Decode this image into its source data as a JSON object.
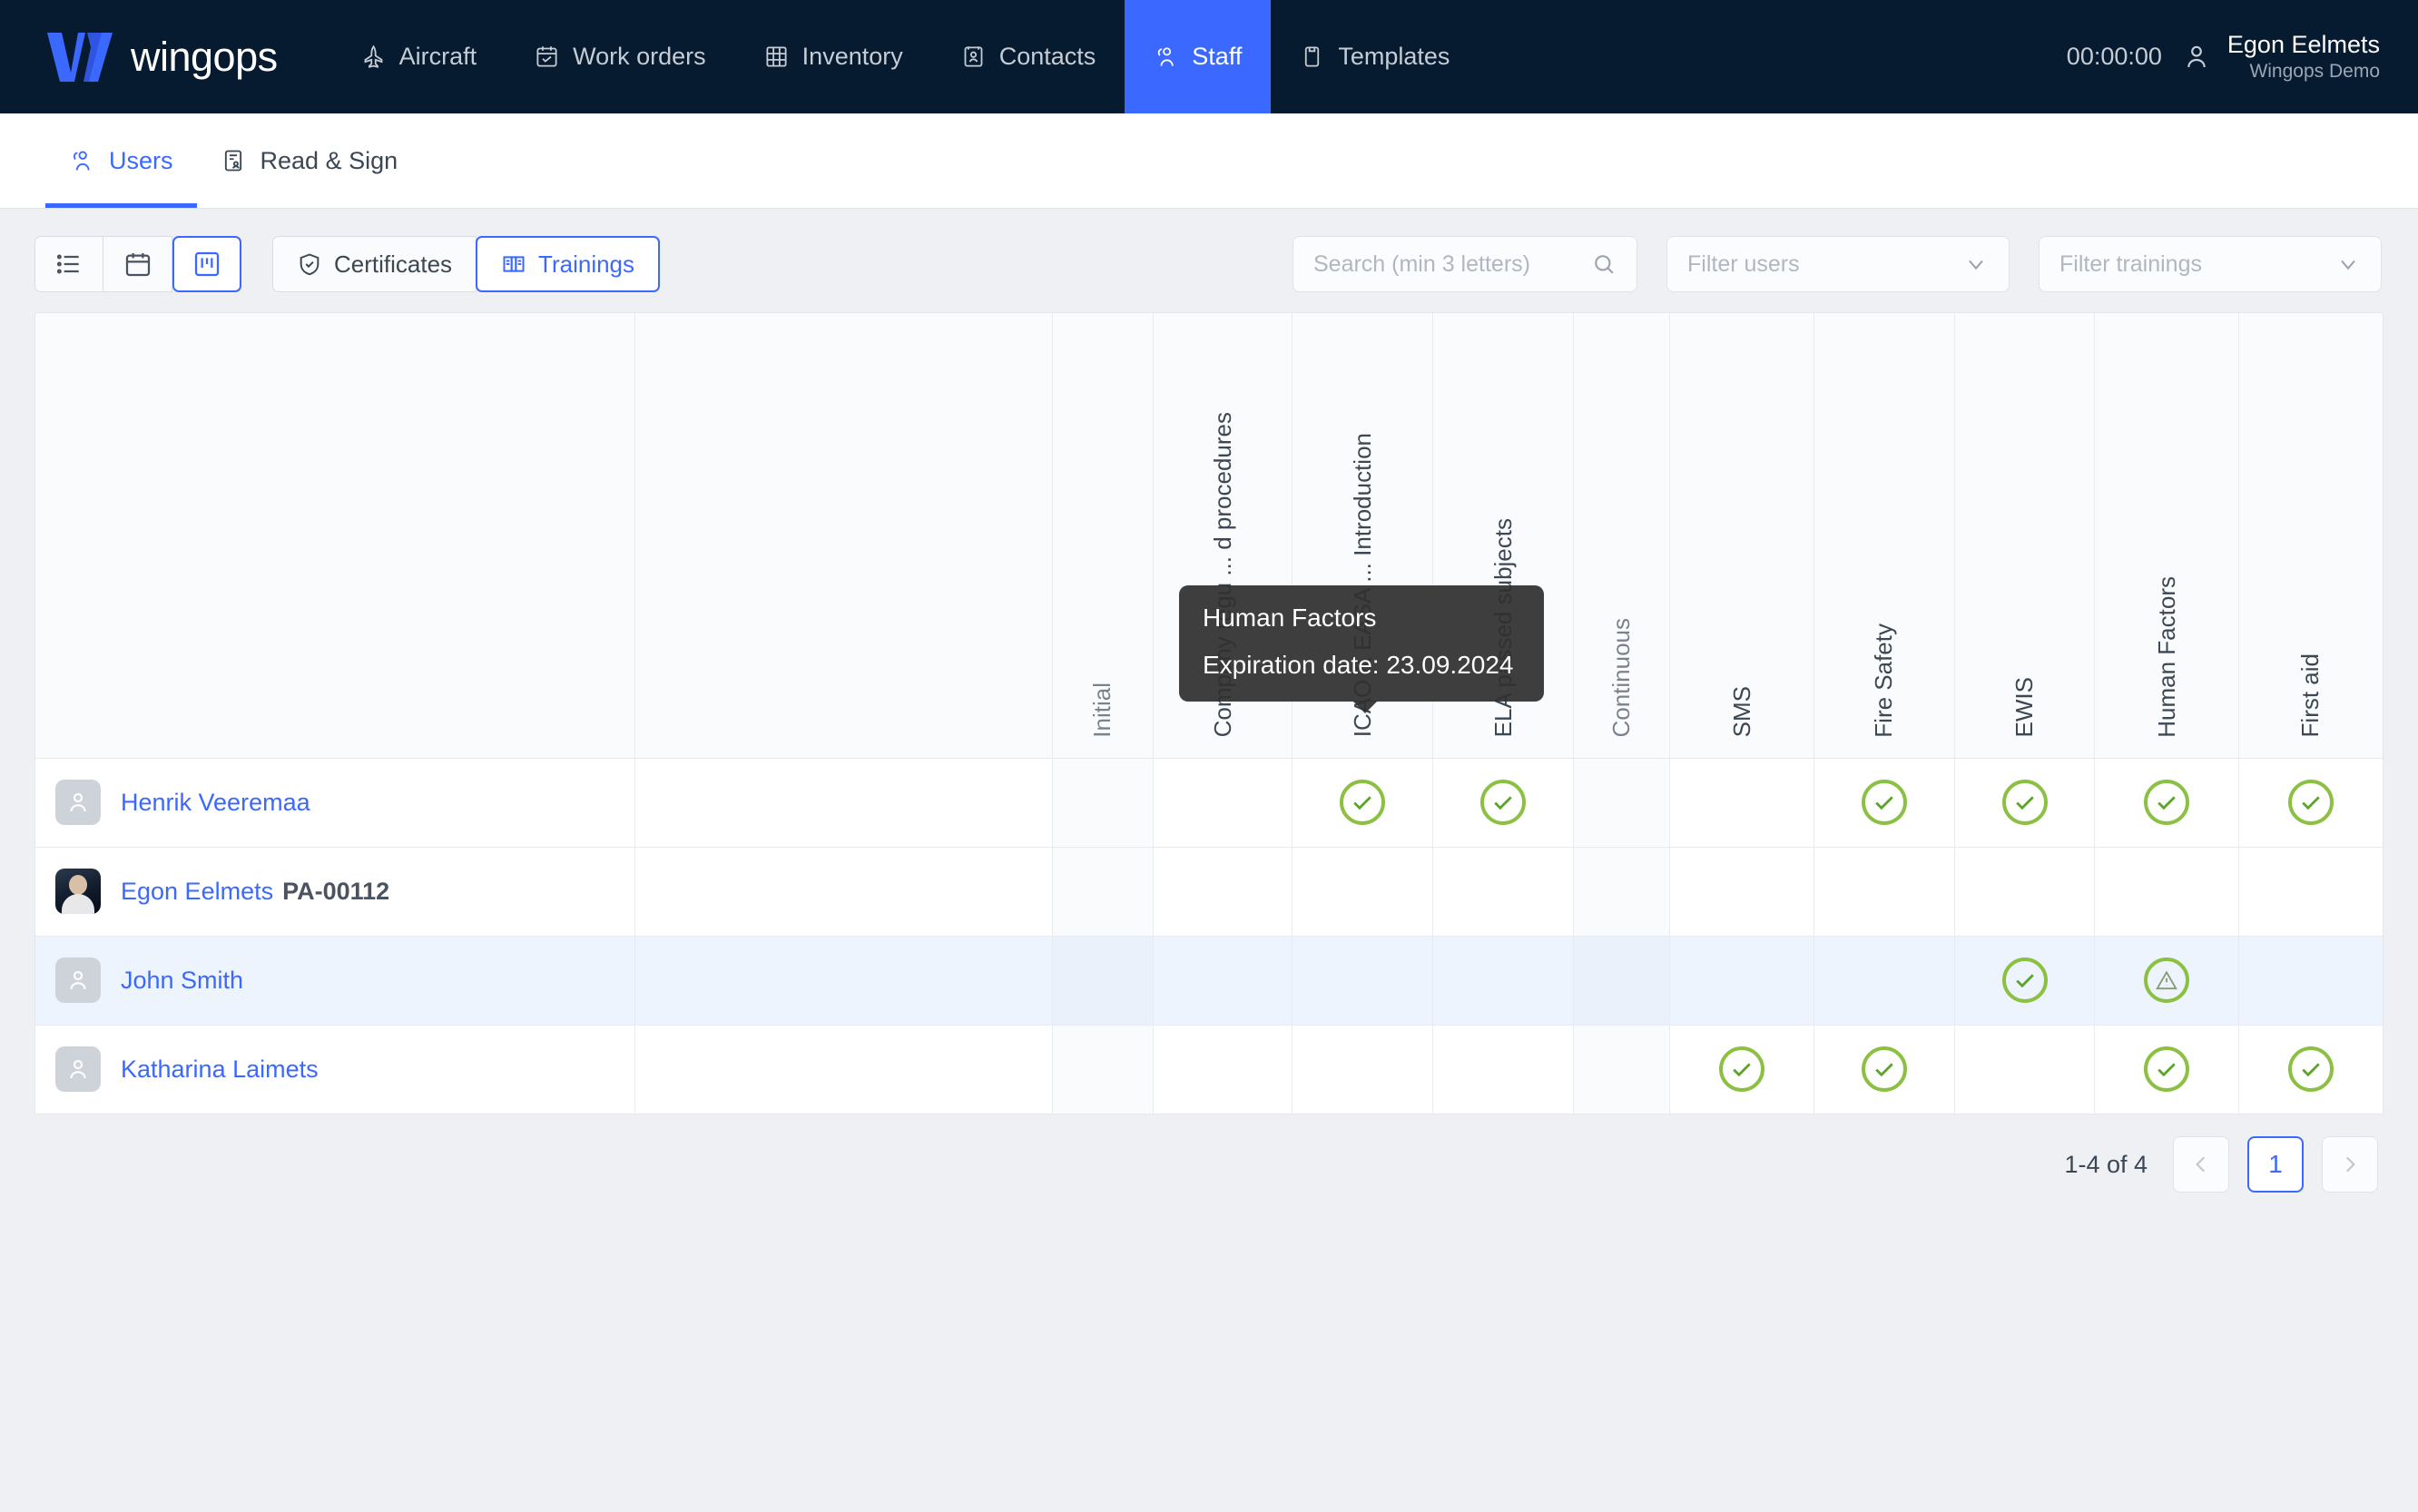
{
  "brand": {
    "name": "wingops"
  },
  "topnav": {
    "items": [
      {
        "label": "Aircraft",
        "icon": "aircraft-icon",
        "active": false
      },
      {
        "label": "Work orders",
        "icon": "workorder-icon",
        "active": false
      },
      {
        "label": "Inventory",
        "icon": "inventory-icon",
        "active": false
      },
      {
        "label": "Contacts",
        "icon": "contacts-icon",
        "active": false
      },
      {
        "label": "Staff",
        "icon": "staff-icon",
        "active": true
      },
      {
        "label": "Templates",
        "icon": "templates-icon",
        "active": false
      }
    ],
    "clock": "00:00:00",
    "user": {
      "name": "Egon Eelmets",
      "org": "Wingops Demo"
    }
  },
  "subtabs": [
    {
      "label": "Users",
      "icon": "users-icon",
      "active": true
    },
    {
      "label": "Read & Sign",
      "icon": "read-sign-icon",
      "active": false
    }
  ],
  "toolbar": {
    "view_buttons": [
      {
        "name": "list-view",
        "icon": "list-icon",
        "active": false
      },
      {
        "name": "calendar-view",
        "icon": "calendar-icon",
        "active": false
      },
      {
        "name": "board-view",
        "icon": "board-icon",
        "active": true
      }
    ],
    "mode_buttons": [
      {
        "label": "Certificates",
        "icon": "shield-check-icon",
        "active": false
      },
      {
        "label": "Trainings",
        "icon": "book-icon",
        "active": true
      }
    ],
    "search": {
      "placeholder": "Search (min 3 letters)",
      "value": ""
    },
    "filter_users": {
      "placeholder": "Filter users",
      "value": ""
    },
    "filter_trainings": {
      "placeholder": "Filter trainings",
      "value": ""
    }
  },
  "table": {
    "columns": [
      {
        "label": "",
        "key": "user",
        "kind": "user"
      },
      {
        "label": "",
        "key": "blank1",
        "kind": "blank"
      },
      {
        "label": "Initial",
        "key": "initial",
        "kind": "group"
      },
      {
        "label": "Company regu ... d procedures",
        "key": "company",
        "kind": "train"
      },
      {
        "label": "ICAO & EASA ... Introduction",
        "key": "icao",
        "kind": "train"
      },
      {
        "label": "ELA passed subjects",
        "key": "ela",
        "kind": "train"
      },
      {
        "label": "Continuous",
        "key": "continuous",
        "kind": "group"
      },
      {
        "label": "SMS",
        "key": "sms",
        "kind": "train"
      },
      {
        "label": "Fire Safety",
        "key": "fire",
        "kind": "train"
      },
      {
        "label": "EWIS",
        "key": "ewis",
        "kind": "train"
      },
      {
        "label": "Human Factors",
        "key": "human",
        "kind": "train"
      },
      {
        "label": "First aid",
        "key": "firstaid",
        "kind": "train"
      }
    ],
    "rows": [
      {
        "name": "Henrik Veeremaa",
        "code": "",
        "avatar": "placeholder",
        "highlight": false,
        "cells": [
          "",
          "",
          "",
          "",
          "check",
          "check",
          "",
          "",
          "check",
          "check",
          "check",
          "check"
        ]
      },
      {
        "name": "Egon Eelmets",
        "code": "PA-00112",
        "avatar": "photo",
        "highlight": false,
        "cells": [
          "",
          "",
          "",
          "",
          "",
          "",
          "",
          "",
          "",
          "",
          "",
          ""
        ]
      },
      {
        "name": "John Smith",
        "code": "",
        "avatar": "placeholder",
        "highlight": true,
        "cells": [
          "",
          "",
          "",
          "",
          "",
          "",
          "",
          "",
          "",
          "check",
          "warning",
          ""
        ]
      },
      {
        "name": "Katharina Laimets",
        "code": "",
        "avatar": "placeholder",
        "highlight": false,
        "cells": [
          "",
          "",
          "",
          "",
          "",
          "",
          "",
          "check",
          "check",
          "",
          "check",
          "check"
        ]
      }
    ]
  },
  "tooltip": {
    "title": "Human Factors",
    "subtitle": "Expiration date: 23.09.2024"
  },
  "pagination": {
    "range_label": "1-4 of 4",
    "prev": "prev-page",
    "current": "1",
    "next": "next-page"
  },
  "colors": {
    "nav_bg": "#061a30",
    "accent": "#3b69ff",
    "status_green": "#8cc043",
    "page_bg": "#eef0f4"
  }
}
